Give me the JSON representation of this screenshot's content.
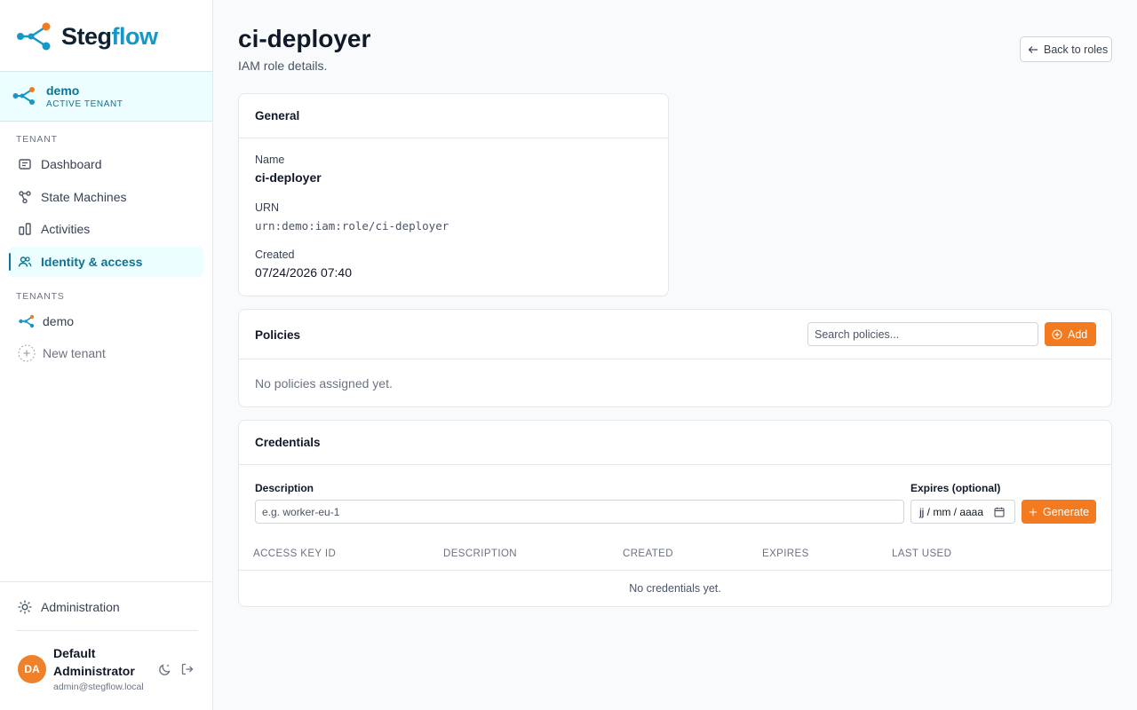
{
  "app": {
    "logo_part1": "Steg",
    "logo_part2": "flow"
  },
  "tenant_selector": {
    "name": "demo",
    "status": "ACTIVE TENANT"
  },
  "sidebar": {
    "tenant_section_label": "TENANT",
    "items": [
      {
        "label": "Dashboard",
        "icon": "dashboard-icon"
      },
      {
        "label": "State Machines",
        "icon": "state-machines-icon"
      },
      {
        "label": "Activities",
        "icon": "activities-icon"
      },
      {
        "label": "Identity & access",
        "icon": "users-icon",
        "active": true
      }
    ],
    "tenants_section_label": "TENANTS",
    "tenants": [
      {
        "label": "demo",
        "icon": "tenant-icon"
      }
    ],
    "new_tenant_label": "New tenant",
    "administration_label": "Administration"
  },
  "user": {
    "initials": "DA",
    "name": "Default Administrator",
    "email": "admin@stegflow.local"
  },
  "page": {
    "title": "ci-deployer",
    "subtitle": "IAM role details.",
    "back_label": "Back to roles"
  },
  "general": {
    "title": "General",
    "name_label": "Name",
    "name_value": "ci-deployer",
    "urn_label": "URN",
    "urn_value": "urn:demo:iam:role/ci-deployer",
    "created_label": "Created",
    "created_value": "07/24/2026 07:40"
  },
  "policies": {
    "title": "Policies",
    "search_placeholder": "Search policies...",
    "add_label": "Add",
    "empty_text": "No policies assigned yet."
  },
  "credentials": {
    "title": "Credentials",
    "description_label": "Description",
    "description_placeholder": "e.g. worker-eu-1",
    "expires_label": "Expires (optional)",
    "expires_placeholder": "jj / mm / aaaa",
    "generate_label": "Generate",
    "columns": [
      "ACCESS KEY ID",
      "DESCRIPTION",
      "CREATED",
      "EXPIRES",
      "LAST USED"
    ],
    "empty_text": "No credentials yet."
  },
  "colors": {
    "accent": "#0e7490",
    "primary_button": "#f37a1f",
    "avatar": "#f0812b"
  }
}
